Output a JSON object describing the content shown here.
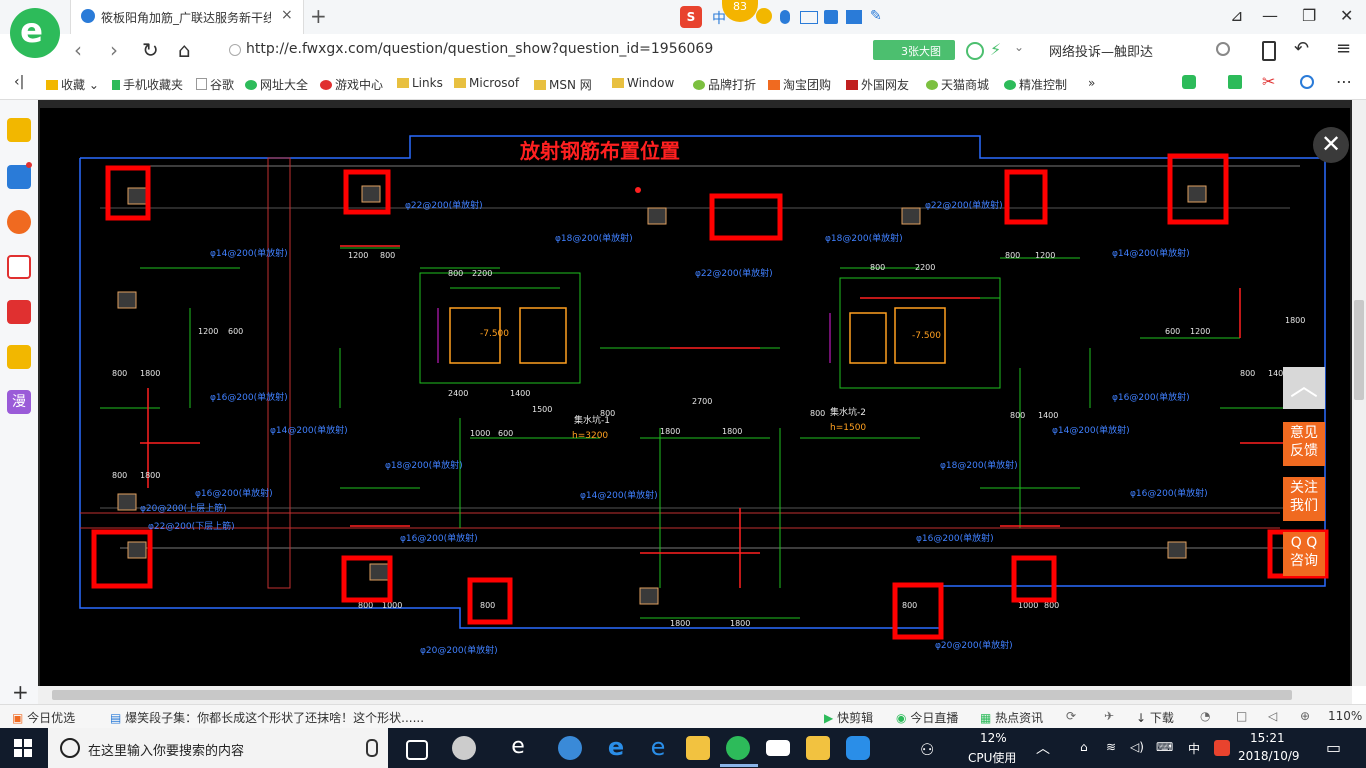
{
  "tab": {
    "title": "筱板阳角加筋_广联达服务新干线",
    "close": "×",
    "new_tab": "+"
  },
  "ime_badge": "83",
  "window_controls": {
    "minimize": "—",
    "maximize": "❐",
    "close": "✕"
  },
  "address": {
    "url": "http://e.fwxgx.com/question/question_show?question_id=1956069",
    "big_image_btn": "3张大图",
    "report": "网络投诉—触即达"
  },
  "bookmarks": [
    {
      "label": "收藏",
      "color": "#f2b700"
    },
    {
      "label": "手机收藏夹",
      "color": "#2dbb5a"
    },
    {
      "label": "谷歌",
      "color": "#cccccc"
    },
    {
      "label": "网址大全",
      "color": "#2dbb5a"
    },
    {
      "label": "游戏中心",
      "color": "#e03030"
    },
    {
      "label": "Links",
      "color": "#e8c040"
    },
    {
      "label": "Microsof",
      "color": "#e8c040"
    },
    {
      "label": "MSN 网",
      "color": "#e8c040"
    },
    {
      "label": "Window",
      "color": "#e8c040"
    },
    {
      "label": "品牌打折",
      "color": "#7cc040"
    },
    {
      "label": "淘宝团购",
      "color": "#f06a20"
    },
    {
      "label": "外国网友",
      "color": "#c02020"
    },
    {
      "label": "天猫商城",
      "color": "#7cc040"
    },
    {
      "label": "精准控制",
      "color": "#2dbb5a"
    }
  ],
  "sidebar": {
    "comic": "漫",
    "add": "+"
  },
  "drawing": {
    "title": "放射钢筋布置位置",
    "rebar_labels": [
      "φ22@200(单放射)",
      "φ18@200(单放射)",
      "φ14@200(单放射)",
      "φ16@200(单放射)",
      "φ20@200(单放射)",
      "φ22@200(下层上筋)",
      "φ20@200(上层上筋)"
    ],
    "dimensions": [
      "800",
      "1200",
      "600",
      "2200",
      "2400",
      "1400",
      "1500",
      "2700",
      "1800",
      "1000",
      "1400",
      "-7.500",
      "h=3200",
      "h=1500",
      "集水坑-1",
      "集水坑-2"
    ]
  },
  "float_buttons": {
    "close": "✕",
    "to_top": "︿",
    "feedback": "意见\n反馈",
    "follow": "关注\n我们",
    "qq": "Q Q\n咨询"
  },
  "status": {
    "today": "今日优选",
    "news": "爆笑段子集：你都长成这个形状了还抹啥！这个形状......",
    "clip": "快剪辑",
    "live": "今日直播",
    "hot": "热点资讯",
    "download": "下载",
    "zoom": "110%"
  },
  "taskbar": {
    "search_placeholder": "在这里输入你要搜索的内容",
    "cpu_pct": "12%",
    "cpu_label": "CPU使用",
    "ime": "中",
    "time": "15:21",
    "date": "2018/10/9"
  }
}
